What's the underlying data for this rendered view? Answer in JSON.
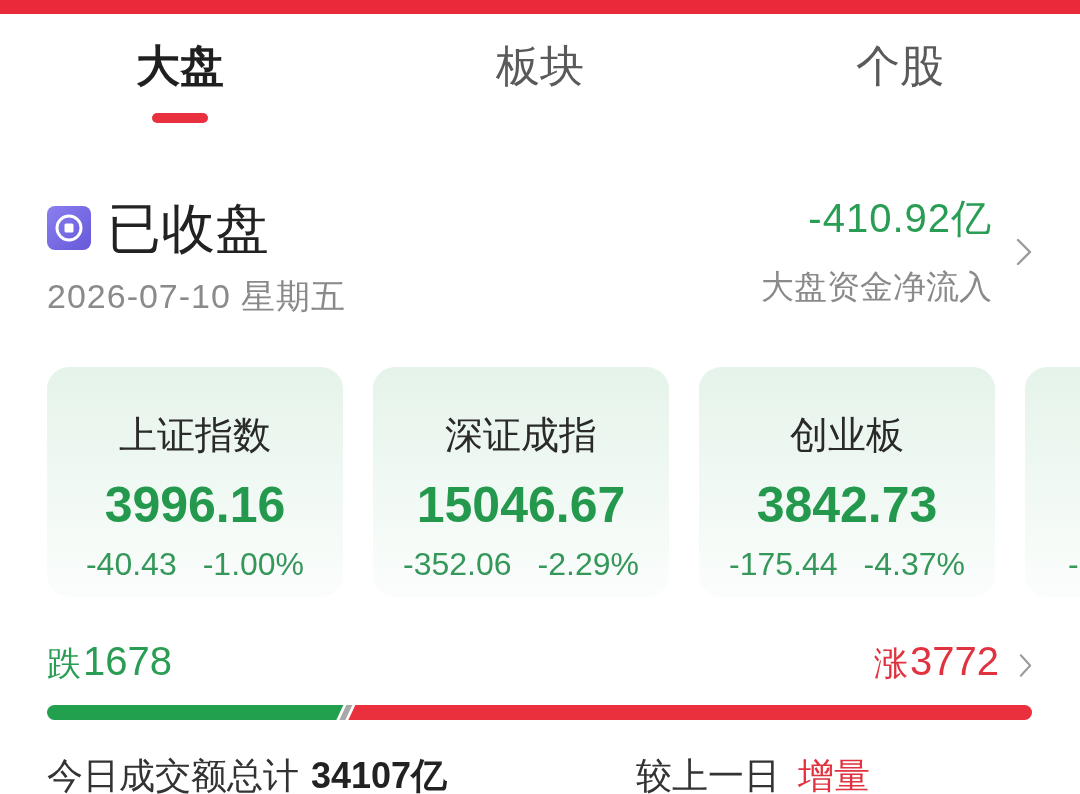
{
  "tabs": [
    {
      "label": "大盘",
      "selected": true
    },
    {
      "label": "板块",
      "selected": false
    },
    {
      "label": "个股",
      "selected": false
    }
  ],
  "market_status": {
    "title": "已收盘",
    "date": "2026-07-10 星期五",
    "net_inflow": "-410.92亿",
    "net_inflow_label": "大盘资金净流入"
  },
  "indices": [
    {
      "name": "上证指数",
      "value": "3996.16",
      "change": "-40.43",
      "change_pct": "-1.00%"
    },
    {
      "name": "深证成指",
      "value": "15046.67",
      "change": "-352.06",
      "change_pct": "-2.29%"
    },
    {
      "name": "创业板",
      "value": "3842.73",
      "change": "-175.44",
      "change_pct": "-4.37%"
    },
    {
      "change": "-"
    }
  ],
  "breadth": {
    "fall_label": "跌",
    "fall_count": "1678",
    "rise_label": "涨",
    "rise_count": "3772",
    "level": 0.31
  },
  "turnover": {
    "label": "今日成交额总计",
    "amount": "34107亿",
    "compare_label": "较上一日",
    "change_label": "增量"
  }
}
